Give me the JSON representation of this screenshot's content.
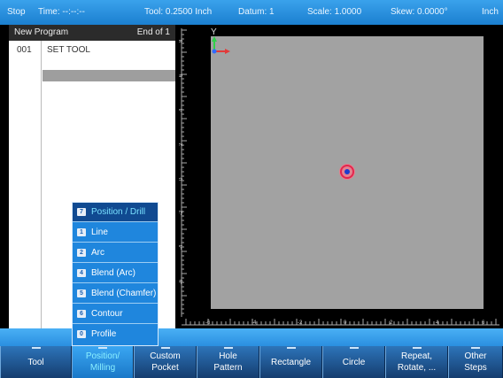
{
  "status": {
    "state": "Stop",
    "time": "Time: --:--:--",
    "tool": "Tool: 0.2500 Inch",
    "datum": "Datum: 1",
    "scale": "Scale: 1.0000",
    "skew": "Skew: 0.0000°",
    "units": "Inch"
  },
  "program": {
    "name": "New Program",
    "position": "End of 1",
    "rows": [
      {
        "num": "001",
        "text": "SET TOOL"
      }
    ]
  },
  "graph": {
    "y_axis_label": "Y",
    "v_ruler_labels": [
      "8",
      "6",
      "4",
      "2",
      "0",
      "-2",
      "-4",
      "-6"
    ],
    "h_ruler_labels": [
      "-6",
      "-4",
      "-2",
      "0",
      "2",
      "4",
      "6"
    ]
  },
  "popup_menu": {
    "items": [
      {
        "key": "7",
        "label": "Position / Drill",
        "active": true
      },
      {
        "key": "1",
        "label": "Line"
      },
      {
        "key": "2",
        "label": "Arc"
      },
      {
        "key": "4",
        "label": "Blend (Arc)"
      },
      {
        "key": "5",
        "label": "Blend (Chamfer)"
      },
      {
        "key": "6",
        "label": "Contour"
      },
      {
        "key": "0",
        "label": "Profile"
      }
    ]
  },
  "softkeys": [
    {
      "line1": "Tool",
      "line2": ""
    },
    {
      "line1": "Position/",
      "line2": "Milling",
      "active": true
    },
    {
      "line1": "Custom",
      "line2": "Pocket"
    },
    {
      "line1": "Hole",
      "line2": "Pattern"
    },
    {
      "line1": "Rectangle",
      "line2": ""
    },
    {
      "line1": "Circle",
      "line2": ""
    },
    {
      "line1": "Repeat,",
      "line2": "Rotate, ..."
    },
    {
      "line1": "Other",
      "line2": "Steps"
    }
  ],
  "colors": {
    "accent": "#1f86dd",
    "active_menu_text": "#79e0ff",
    "plot_background": "#a2a2a2",
    "marker": "#e2264d"
  }
}
